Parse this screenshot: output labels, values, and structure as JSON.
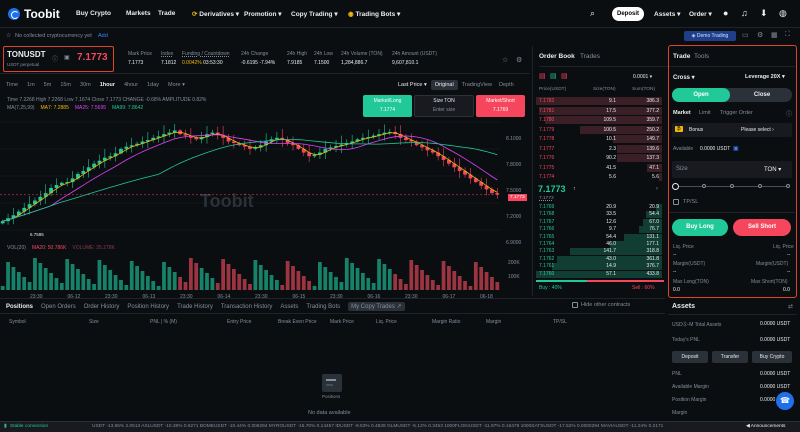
{
  "nav": {
    "logo": "Toobit",
    "items": [
      "Buy Crypto",
      "Markets",
      "Trade",
      "Derivatives",
      "Promotion",
      "Copy Trading",
      "Trading Bots"
    ],
    "deposit": "Deposit",
    "assets": "Assets",
    "order": "Order"
  },
  "notice": {
    "text": "No collected cryptocurrency yet",
    "add": "Add",
    "demo": "Demo Trading"
  },
  "ticker": {
    "pair": "TONUSDT",
    "sub": "USDT perpetual",
    "price": "7.1773",
    "stats": [
      {
        "label": "Mark Price",
        "value": "7.1773"
      },
      {
        "label": "Index",
        "value": "7.1812"
      },
      {
        "label": "Funding / Countdown",
        "value": "0.0042%",
        "value2": "03:53:30"
      },
      {
        "label": "24h Change",
        "value": "-0.6195 -7.94%"
      },
      {
        "label": "24h High",
        "value": "7.9185"
      },
      {
        "label": "24h Low",
        "value": "7.1500"
      },
      {
        "label": "24h Volume (TON)",
        "value": "1,284,886.7"
      },
      {
        "label": "24h Amount (USDT)",
        "value": "9,607,810.1"
      }
    ]
  },
  "chart": {
    "timeframes": [
      "Time",
      "1m",
      "5m",
      "15m",
      "30m",
      "1hour",
      "4hour",
      "1day",
      "More"
    ],
    "active_tf": "1hour",
    "views": [
      "Last Price",
      "Original",
      "TradingView",
      "Depth"
    ],
    "ohlc": "Time 7.2268  High 7.2268  Low 7.1674  Close 7.1773  CHANGE -0.68%  AMPLITUDE 0.82%",
    "ma": {
      "ma7": "MA(7,25,99)",
      "ma7v": "MA7: 7.2885",
      "ma25v": "MA25: 7.5695",
      "ma99v": "MA99: 7.8642"
    },
    "vol": {
      "label": "VOL(20)",
      "ma5": "MA20: 50.786K",
      "vol": "VOLUME: 35.278K"
    },
    "watermark": "Toobit",
    "price_ticks": [
      "8.1000",
      "7.8000",
      "7.5000",
      "7.2000",
      "6.9000"
    ],
    "vol_ticks": [
      "200K",
      "100K"
    ],
    "x_ticks": [
      "23:30",
      "06-12",
      "23:30",
      "06-13",
      "23:30",
      "06-14",
      "23:30",
      "06-15",
      "23:30",
      "06-16",
      "23:30",
      "06-17",
      "06-18"
    ],
    "last_marker": "7.1773",
    "low_marker": "6.7595",
    "quick": {
      "long": "Market/Long",
      "long_px": "7.1774",
      "size": "Size TON",
      "size_ph": "Enter size",
      "short": "Market/Short",
      "short_px": "7.1769"
    }
  },
  "chart_data": {
    "type": "candlestick",
    "y_range": [
      6.7,
      8.3
    ],
    "candles_close": [
      6.82,
      6.86,
      6.9,
      6.95,
      7.0,
      7.05,
      7.1,
      7.15,
      7.2,
      7.27,
      7.31,
      7.34,
      7.35,
      7.4,
      7.46,
      7.5,
      7.55,
      7.6,
      7.64,
      7.68,
      7.7,
      7.74,
      7.8,
      7.83,
      7.85,
      7.87,
      7.9,
      7.92,
      7.95,
      7.97,
      8.0,
      8.02,
      8.05,
      8.0,
      7.98,
      7.95,
      7.93,
      7.96,
      8.0,
      8.02,
      7.99,
      7.95,
      7.9,
      7.88,
      7.85,
      7.83,
      7.8,
      7.82,
      7.85,
      7.9,
      7.93,
      7.95,
      7.92,
      7.88,
      7.85,
      7.8,
      7.75,
      7.7,
      7.72,
      7.75,
      7.8,
      7.82,
      7.84,
      7.86,
      7.88,
      7.9,
      7.93,
      7.95,
      7.96,
      7.98,
      8.0,
      8.02,
      8.03,
      8.0,
      7.95,
      7.92,
      7.9,
      7.85,
      7.82,
      7.78,
      7.75,
      7.7,
      7.65,
      7.6,
      7.55,
      7.5,
      7.45,
      7.4,
      7.35,
      7.3,
      7.25,
      7.2,
      7.18
    ]
  },
  "orderbook": {
    "tabs": [
      "Order Book",
      "Trades"
    ],
    "precision": "0.0001",
    "headers": [
      "Price(USDT)",
      "Size(TON)",
      "Sum(TON)"
    ],
    "asks": [
      [
        "7.1782",
        "9.1",
        "386.3"
      ],
      [
        "7.1781",
        "17.5",
        "377.2"
      ],
      [
        "7.1780",
        "109.5",
        "359.7"
      ],
      [
        "7.1779",
        "100.5",
        "250.2"
      ],
      [
        "7.1778",
        "10.1",
        "149.7"
      ],
      [
        "7.1777",
        "2.3",
        "139.6"
      ],
      [
        "7.1776",
        "90.2",
        "137.3"
      ],
      [
        "7.1775",
        "41.5",
        "47.1"
      ],
      [
        "7.1774",
        "5.6",
        "5.6"
      ]
    ],
    "ask_depth": [
      1.0,
      0.98,
      0.93,
      0.65,
      0.39,
      0.36,
      0.36,
      0.12,
      0.02
    ],
    "mid": "7.1773",
    "mid_sub": "7.1773",
    "bids": [
      [
        "7.1769",
        "20.9",
        "20.9"
      ],
      [
        "7.1768",
        "33.5",
        "54.4"
      ],
      [
        "7.1767",
        "12.6",
        "67.0"
      ],
      [
        "7.1766",
        "9.7",
        "76.7"
      ],
      [
        "7.1765",
        "54.4",
        "131.1"
      ],
      [
        "7.1764",
        "46.0",
        "177.1"
      ],
      [
        "7.1763",
        "141.7",
        "318.8"
      ],
      [
        "7.1762",
        "43.0",
        "361.8"
      ],
      [
        "7.1761",
        "14.9",
        "376.7"
      ],
      [
        "7.1760",
        "57.1",
        "433.8"
      ]
    ],
    "bid_depth": [
      0.05,
      0.13,
      0.15,
      0.18,
      0.3,
      0.41,
      0.73,
      0.83,
      0.87,
      1.0
    ],
    "buy": "Buy : 40%",
    "sell": "Sell : 60%",
    "buy_ratio": 0.4
  },
  "trade": {
    "tabs": [
      "Trade",
      "Tools"
    ],
    "margin_mode": "Cross",
    "leverage": "Leverage 20X",
    "open": "Open",
    "close": "Close",
    "types": [
      "Market",
      "Limit",
      "Trigger Order"
    ],
    "bonus": "Bonus",
    "bonus_select": "Please select",
    "available": "Available",
    "available_val": "0.0000 USDT",
    "size": "Size",
    "size_unit": "TON",
    "slider_pct": 0,
    "tpsl": "TP/SL",
    "buy_long": "Buy Long",
    "sell_short": "Sell Short",
    "liq_price": "Liq. Price",
    "liq_val": "--",
    "margin": "Margin(USDT)",
    "margin_val": "--",
    "max_long": "Max Long(TON)",
    "max_long_val": "0.0",
    "max_short": "Max Short(TON)",
    "max_short_val": "0.0"
  },
  "positions": {
    "tabs": [
      "Positions",
      "Open Orders",
      "Order History",
      "Position History",
      "Trade History",
      "Transaction History",
      "Assets",
      "Trading Bots",
      "My Copy Trades"
    ],
    "hide_label": "Hide other contracts",
    "columns": [
      "Symbol",
      "Size",
      "PNL | % (M)",
      "Entry Price",
      "Break Even Price",
      "Mark Price",
      "Liq. Price",
      "Margin Ratio",
      "Margin",
      "TP/SL"
    ],
    "empty": "No data available",
    "empty_label": "Positions"
  },
  "assets": {
    "title": "Assets",
    "total_label": "USDⓈ-M Total Assets",
    "total_val": "0.0000 USDT",
    "pnl_label": "Today's PNL",
    "pnl_val": "0.0000 USDT",
    "buttons": [
      "Deposit",
      "Transfer",
      "Buy Crypto"
    ],
    "rows": [
      {
        "label": "PNL",
        "value": "0.0000 USDT"
      },
      {
        "label": "Available Margin",
        "value": "0.0000 USDT"
      },
      {
        "label": "Position Margin",
        "value": "0.0000 USDT"
      },
      {
        "label": "Margin",
        "value": ""
      }
    ]
  },
  "footer": {
    "status": "Stable connection",
    "ticker": "USDT -13.65% 2.0513  AXLUSDT -10.38% 0.6271  BOMEUSDT -10.44% 0.008294  MYROUSDT -15.70% 0.14457  IDUSDT -9.53% 0.4828  GLMUSDT -5.12% 0.3453  1000FLOKIUSDT -11.97% 0.16479  1000SATSUSDT -17.52% 0.0000294  MAVIAUSDT -11.24% 0.2171",
    "announcements": "Announcements"
  }
}
